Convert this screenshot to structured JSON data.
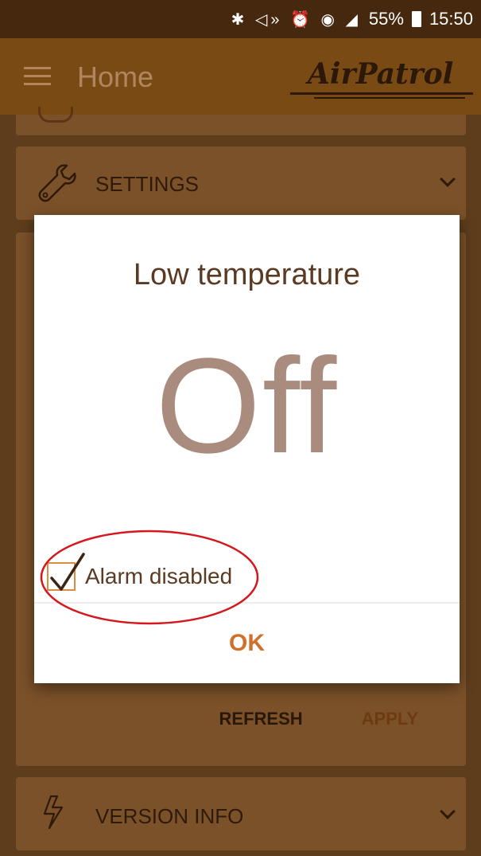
{
  "status_bar": {
    "icons": "✱ ◁» ⏰ ◉ ◢",
    "battery": "55%",
    "time": "15:50"
  },
  "app_bar": {
    "title": "Home",
    "logo": "AirPatrol"
  },
  "cards": {
    "settings_label": "SETTINGS",
    "version_label": "VERSION INFO"
  },
  "actions": {
    "refresh": "REFRESH",
    "apply": "APPLY"
  },
  "dialog": {
    "title": "Low temperature",
    "value": "Off",
    "alarm_label": "Alarm disabled",
    "alarm_checked": true,
    "ok_label": "OK"
  },
  "colors": {
    "accent": "#d0702a",
    "annotation": "#d4181e"
  }
}
